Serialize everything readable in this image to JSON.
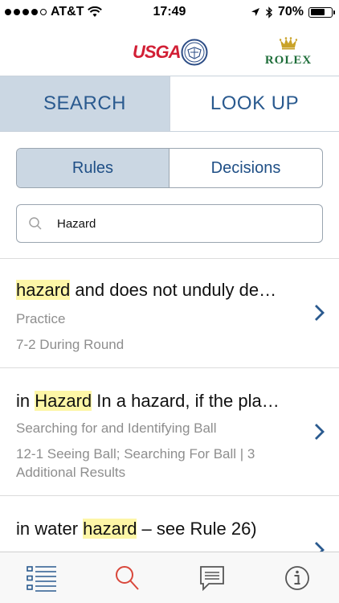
{
  "status_bar": {
    "carrier": "AT&T",
    "time": "17:49",
    "battery": "70%",
    "battery_level": 0.7
  },
  "logos": {
    "usga": "USGA",
    "rolex": "ROLEX"
  },
  "main_tabs": [
    {
      "label": "SEARCH",
      "active": true
    },
    {
      "label": "LOOK UP",
      "active": false
    }
  ],
  "segmented": [
    {
      "label": "Rules",
      "active": true
    },
    {
      "label": "Decisions",
      "active": false
    }
  ],
  "search": {
    "value": "Hazard"
  },
  "results": [
    {
      "title_pre": "",
      "title_highlight": "hazard",
      "title_post": " and does not unduly de…",
      "subtitle": "Practice",
      "detail": "7-2 During Round"
    },
    {
      "title_pre": "in ",
      "title_highlight": "Hazard",
      "title_post": " In a hazard, if the pla…",
      "subtitle": "Searching for and Identifying Ball",
      "detail": "12-1 Seeing Ball; Searching For Ball  |  3 Additional Results"
    },
    {
      "title_pre": "in water ",
      "title_highlight": "hazard",
      "title_post": " – see Rule 26)"
    }
  ],
  "tabbar": [
    {
      "icon": "list-icon",
      "active": false
    },
    {
      "icon": "search-icon",
      "active": true
    },
    {
      "icon": "chat-icon",
      "active": false
    },
    {
      "icon": "info-icon",
      "active": false
    }
  ],
  "colors": {
    "accent_blue": "#2a5a8f",
    "tab_active_bg": "#cbd7e3",
    "highlight": "#fdf6a6",
    "usga_red": "#d21f35",
    "rolex_green": "#1f6e3a",
    "tab_active_icon": "#d9473b"
  }
}
